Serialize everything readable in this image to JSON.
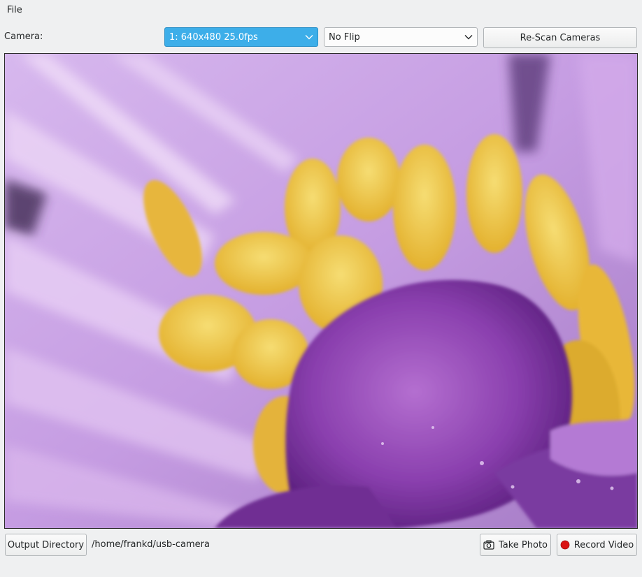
{
  "menu": {
    "items": [
      {
        "label": "File"
      }
    ]
  },
  "camera": {
    "label": "Camera:",
    "selected": "1: 640x480 25.0fps",
    "accent_color": "#3daee9"
  },
  "flip": {
    "selected": "No Flip"
  },
  "rescan_button": {
    "label": "Re-Scan Cameras"
  },
  "preview": {
    "description_icon": "camera-preview"
  },
  "output": {
    "button_label": "Output Directory",
    "path": "/home/frankd/usb-camera"
  },
  "take_photo": {
    "label": "Take Photo",
    "icon": "camera-icon"
  },
  "record_video": {
    "label": "Record Video",
    "icon": "record-icon",
    "icon_color": "#da1313"
  }
}
